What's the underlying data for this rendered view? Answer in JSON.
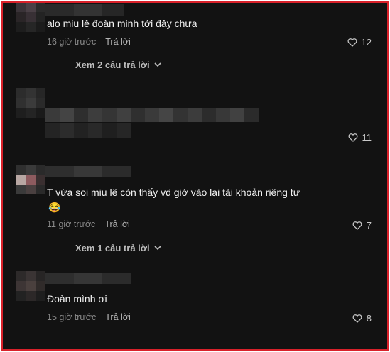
{
  "comments": [
    {
      "text": "alo miu lê đoàn minh tới đây chưa",
      "time": "16 giờ trước",
      "reply_label": "Trả lời",
      "likes": "12",
      "view_replies": "Xem 2 câu trả lời"
    },
    {
      "text": "",
      "likes": "11"
    },
    {
      "text": "T vừa soi miu lê còn thấy vd giờ vào lại tài khoản riêng tư",
      "emoji": "😂",
      "time": "11 giờ trước",
      "reply_label": "Trả lời",
      "likes": "7",
      "view_replies": "Xem 1 câu trả lời"
    },
    {
      "text": "Đoàn mình ơi",
      "time": "15 giờ trước",
      "reply_label": "Trả lời",
      "likes": "8"
    }
  ],
  "colors": {
    "background": "#121212",
    "border": "#d9212a",
    "text": "#f2f2f2",
    "meta": "#8a8a8a"
  },
  "icons": {
    "like": "heart-outline-icon",
    "expand": "chevron-down-icon",
    "emoji": "face-with-tears-of-joy"
  }
}
